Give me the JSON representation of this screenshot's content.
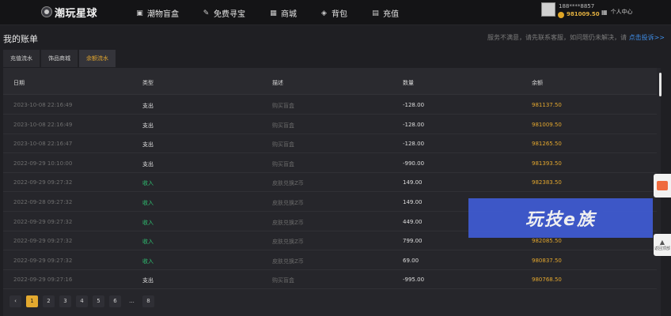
{
  "app": {
    "name": "潮玩星球"
  },
  "nav": [
    {
      "label": "潮物盲盒",
      "icon": "box-icon"
    },
    {
      "label": "免费寻宝",
      "icon": "edit-icon"
    },
    {
      "label": "商城",
      "icon": "shop-icon"
    },
    {
      "label": "背包",
      "icon": "backpack-icon"
    },
    {
      "label": "充值",
      "icon": "wallet-icon"
    }
  ],
  "user": {
    "phone": "188****8857",
    "balance": "981009.50",
    "center_label": "个人中心"
  },
  "page": {
    "title": "我的账单",
    "service_note": "服务不满意，请先联系客服，如问题仍未解决，请",
    "service_link": "点击投诉>>"
  },
  "tabs": [
    {
      "label": "充值流水",
      "active": false
    },
    {
      "label": "饰品商城",
      "active": false
    },
    {
      "label": "余额流水",
      "active": true
    }
  ],
  "table": {
    "headers": [
      "日期",
      "类型",
      "描述",
      "数量",
      "余额"
    ],
    "rows": [
      {
        "date": "2023-10-08 22:16:49",
        "type": "支出",
        "desc": "购买盲盒",
        "amount": "-128.00",
        "balance": "981137.50"
      },
      {
        "date": "2023-10-08 22:16:49",
        "type": "支出",
        "desc": "购买盲盒",
        "amount": "-128.00",
        "balance": "981009.50"
      },
      {
        "date": "2023-10-08 22:16:47",
        "type": "支出",
        "desc": "购买盲盒",
        "amount": "-128.00",
        "balance": "981265.50"
      },
      {
        "date": "2022-09-29 10:10:00",
        "type": "支出",
        "desc": "购买盲盒",
        "amount": "-990.00",
        "balance": "981393.50"
      },
      {
        "date": "2022-09-29 09:27:32",
        "type": "收入",
        "desc": "皮肤兑换Z币",
        "amount": "149.00",
        "balance": "982383.50"
      },
      {
        "date": "2022-09-28 09:27:32",
        "type": "收入",
        "desc": "皮肤兑换Z币",
        "amount": "149.00",
        "balance": ""
      },
      {
        "date": "2022-09-29 09:27:32",
        "type": "收入",
        "desc": "皮肤兑换Z币",
        "amount": "449.00",
        "balance": ""
      },
      {
        "date": "2022-09-29 09:27:32",
        "type": "收入",
        "desc": "皮肤兑换Z币",
        "amount": "799.00",
        "balance": "982085.50"
      },
      {
        "date": "2022-09-29 09:27:32",
        "type": "收入",
        "desc": "皮肤兑换Z币",
        "amount": "69.00",
        "balance": "980837.50"
      },
      {
        "date": "2022-09-29 09:27:16",
        "type": "支出",
        "desc": "购买盲盒",
        "amount": "-995.00",
        "balance": "980768.50"
      }
    ]
  },
  "pagination": {
    "prev": "‹",
    "pages": [
      "1",
      "2",
      "3",
      "4",
      "5",
      "6",
      "...",
      "8"
    ],
    "current": "1"
  },
  "watermark": {
    "text": "玩技e族"
  },
  "side": {
    "top_label": "返回顶部"
  },
  "colors": {
    "accent": "#e2a62e",
    "income": "#2fbf71",
    "link": "#3f8ee8",
    "watermark_bg": "#3f5bd3"
  }
}
